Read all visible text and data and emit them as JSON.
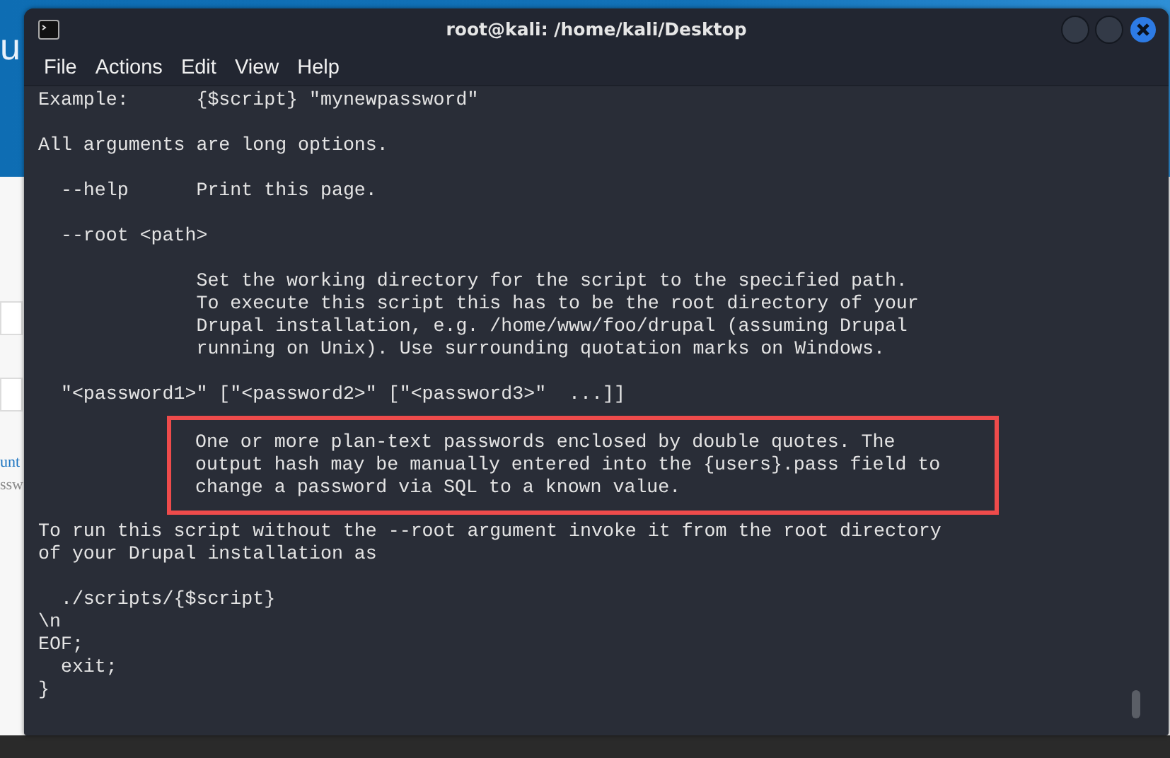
{
  "background_page": {
    "site_title": "u",
    "links": [
      {
        "text": "unt",
        "kind": "link"
      },
      {
        "text": "ssw",
        "kind": "plain"
      }
    ]
  },
  "window": {
    "title": "root@kali: /home/kali/Desktop",
    "menu": [
      "File",
      "Actions",
      "Edit",
      "View",
      "Help"
    ]
  },
  "terminal": {
    "blocks": [
      {
        "kind": "line",
        "text": "Example:      {$script} \"mynewpassword\""
      },
      {
        "kind": "gap"
      },
      {
        "kind": "line",
        "text": "All arguments are long options."
      },
      {
        "kind": "gap"
      },
      {
        "kind": "line",
        "text": "  --help      Print this page."
      },
      {
        "kind": "gap"
      },
      {
        "kind": "line",
        "text": "  --root <path>"
      },
      {
        "kind": "gap"
      },
      {
        "kind": "line",
        "text": "              Set the working directory for the script to the specified path."
      },
      {
        "kind": "line",
        "text": "              To execute this script this has to be the root directory of your"
      },
      {
        "kind": "line",
        "text": "              Drupal installation, e.g. /home/www/foo/drupal (assuming Drupal"
      },
      {
        "kind": "line",
        "text": "              running on Unix). Use surrounding quotation marks on Windows."
      },
      {
        "kind": "gap"
      },
      {
        "kind": "line",
        "text": "  \"<password1>\" [\"<password2>\" [\"<password3>\"  ...]]"
      },
      {
        "kind": "highlight",
        "lines": [
          "One or more plan-text passwords enclosed by double quotes. The",
          "output hash may be manually entered into the {users}.pass field to",
          "change a password via SQL to a known value."
        ]
      },
      {
        "kind": "line",
        "text": "To run this script without the --root argument invoke it from the root directory"
      },
      {
        "kind": "line",
        "text": "of your Drupal installation as"
      },
      {
        "kind": "gap"
      },
      {
        "kind": "line",
        "text": "  ./scripts/{$script}"
      },
      {
        "kind": "line",
        "text": "\\n"
      },
      {
        "kind": "line",
        "text": "EOF;"
      },
      {
        "kind": "line",
        "text": "  exit;"
      },
      {
        "kind": "line",
        "text": "}"
      }
    ]
  }
}
